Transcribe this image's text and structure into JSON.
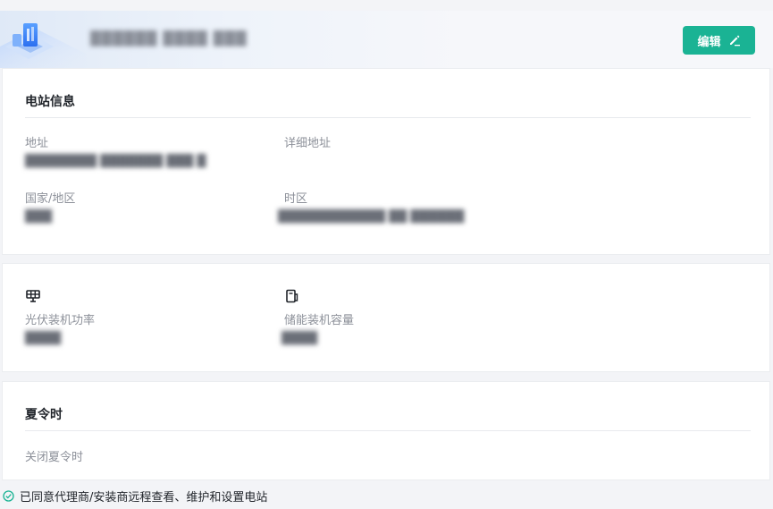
{
  "header": {
    "station_name": "██████ ████ ███",
    "edit_label": "编辑",
    "colors": {
      "accent": "#1ab394"
    }
  },
  "station_info": {
    "title": "电站信息",
    "fields": {
      "address": {
        "label": "地址",
        "value": "████████ ███████ ███ █"
      },
      "detailed_address": {
        "label": "详细地址",
        "value": ""
      },
      "country_region": {
        "label": "国家/地区",
        "value": "███"
      },
      "timezone": {
        "label": "时区",
        "value": "████████████ ██ ██████"
      }
    }
  },
  "capacity": {
    "pv_capacity": {
      "icon": "solar-panel-icon",
      "label": "光伏装机功率",
      "value": "████"
    },
    "storage_capacity": {
      "icon": "battery-storage-icon",
      "label": "储能装机容量",
      "value": "████"
    }
  },
  "dst": {
    "title": "夏令时",
    "status": "关闭夏令时"
  },
  "agreement": {
    "icon": "check-circle-icon",
    "text": "已同意代理商/安装商远程查看、维护和设置电站"
  }
}
